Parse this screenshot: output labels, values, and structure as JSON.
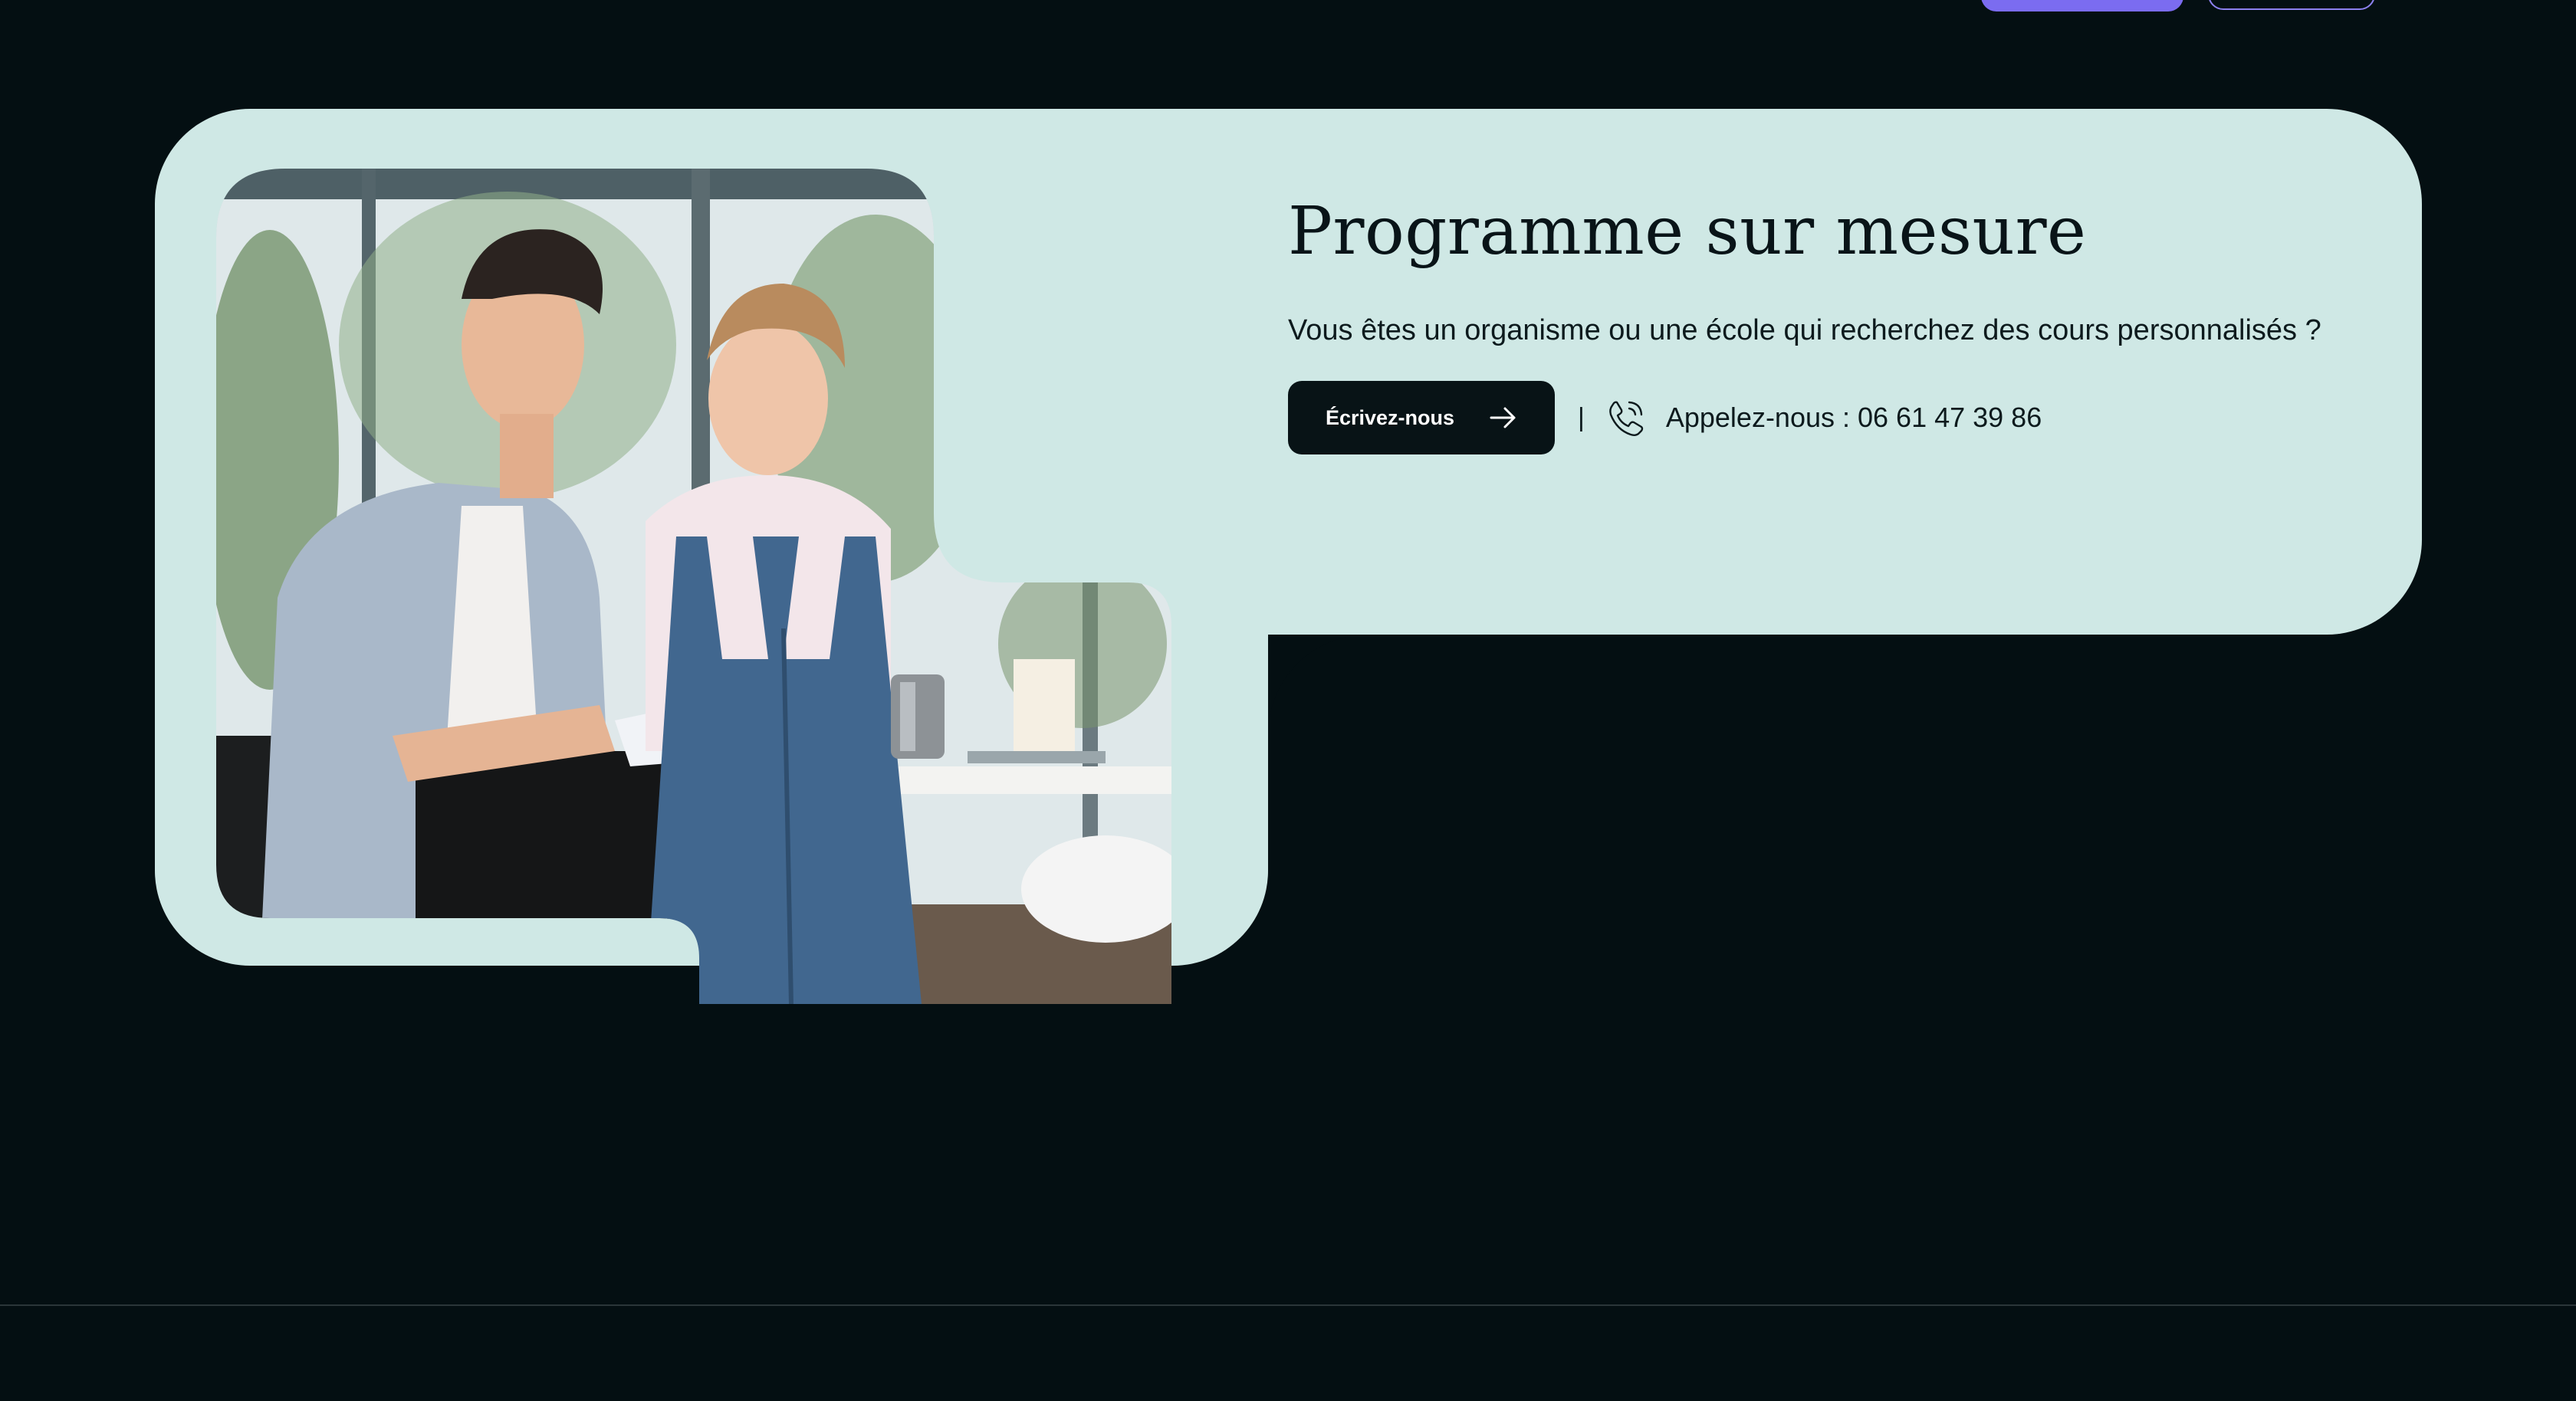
{
  "header": {
    "primary_button_label": "",
    "secondary_button_label": ""
  },
  "section": {
    "title": "Programme sur mesure",
    "subtitle": "Vous êtes un organisme ou une école qui recherchez des cours personnalisés ?",
    "write_button_label": "Écrivez-nous",
    "separator": "|",
    "phone_label": "Appelez-nous : 06 61 47 39 86",
    "image_alt": "Deux personnes consultant un document dans un bureau"
  },
  "icons": {
    "write_button_icon": "arrow-right-icon",
    "phone_icon": "phone-ringing-icon"
  },
  "colors": {
    "page_background": "#040f12",
    "card_background": "#cfe8e5",
    "button_background": "#081316",
    "accent": "#7b6cf0"
  }
}
